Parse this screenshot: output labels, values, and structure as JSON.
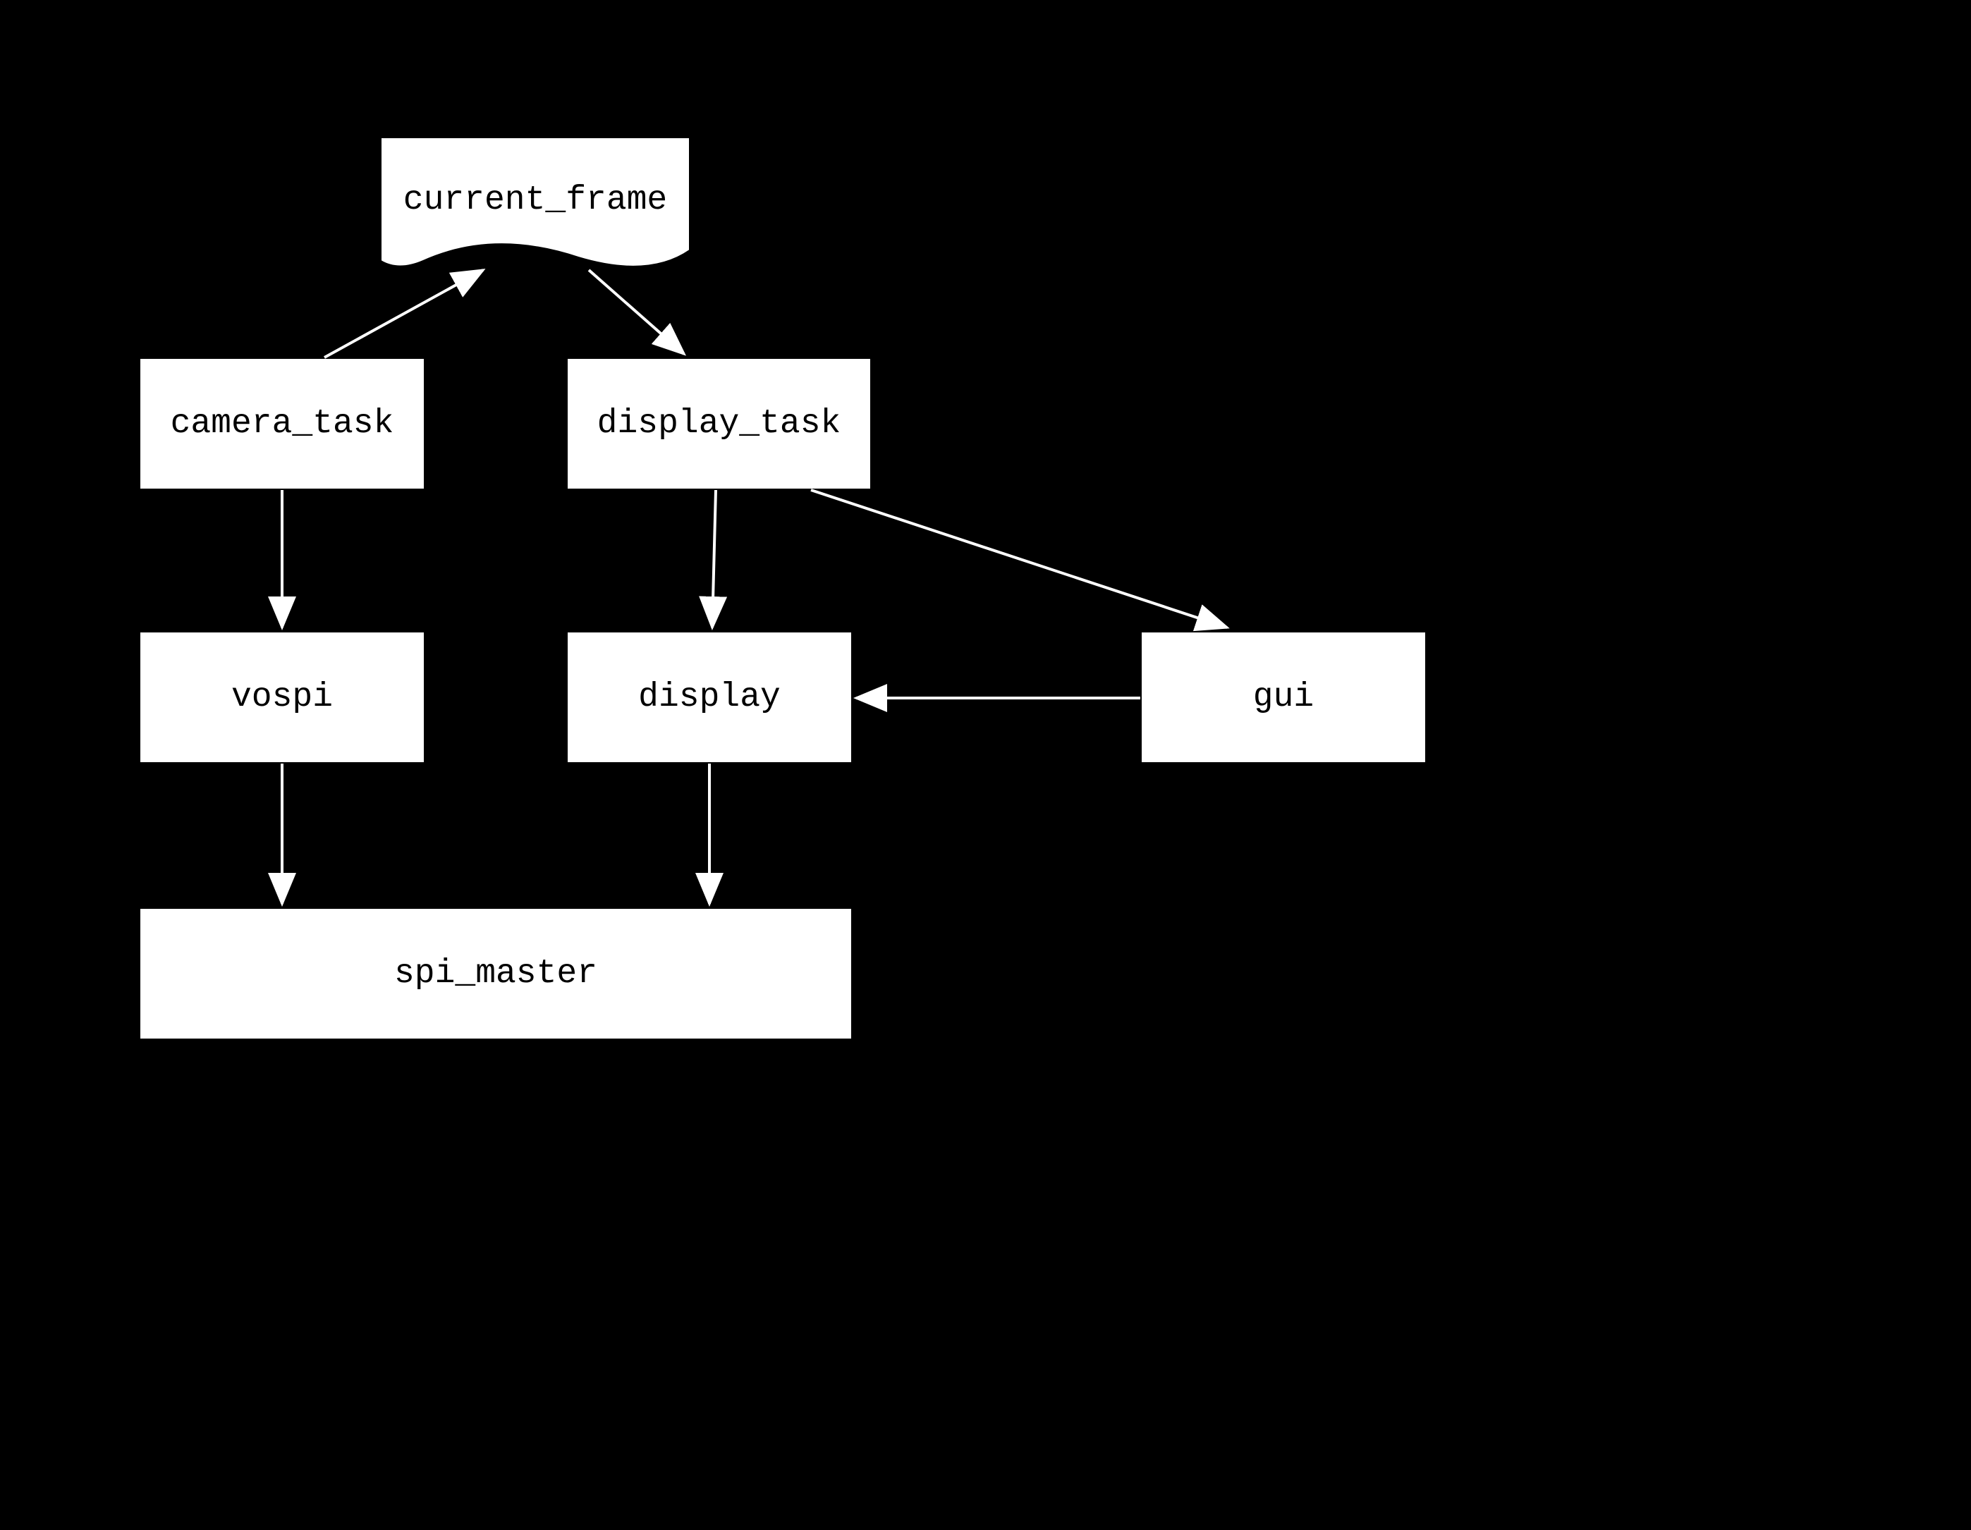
{
  "nodes": {
    "current_frame": {
      "label": "current_frame",
      "type": "document"
    },
    "camera_task": {
      "label": "camera_task",
      "type": "process"
    },
    "display_task": {
      "label": "display_task",
      "type": "process"
    },
    "vospi": {
      "label": "vospi",
      "type": "process"
    },
    "display": {
      "label": "display",
      "type": "process"
    },
    "gui": {
      "label": "gui",
      "type": "process"
    },
    "spi_master": {
      "label": "spi_master",
      "type": "process"
    }
  },
  "edges": [
    {
      "from": "camera_task",
      "to": "current_frame"
    },
    {
      "from": "current_frame",
      "to": "display_task"
    },
    {
      "from": "camera_task",
      "to": "vospi"
    },
    {
      "from": "display_task",
      "to": "display"
    },
    {
      "from": "display_task",
      "to": "gui"
    },
    {
      "from": "gui",
      "to": "display"
    },
    {
      "from": "vospi",
      "to": "spi_master"
    },
    {
      "from": "display",
      "to": "spi_master"
    }
  ]
}
